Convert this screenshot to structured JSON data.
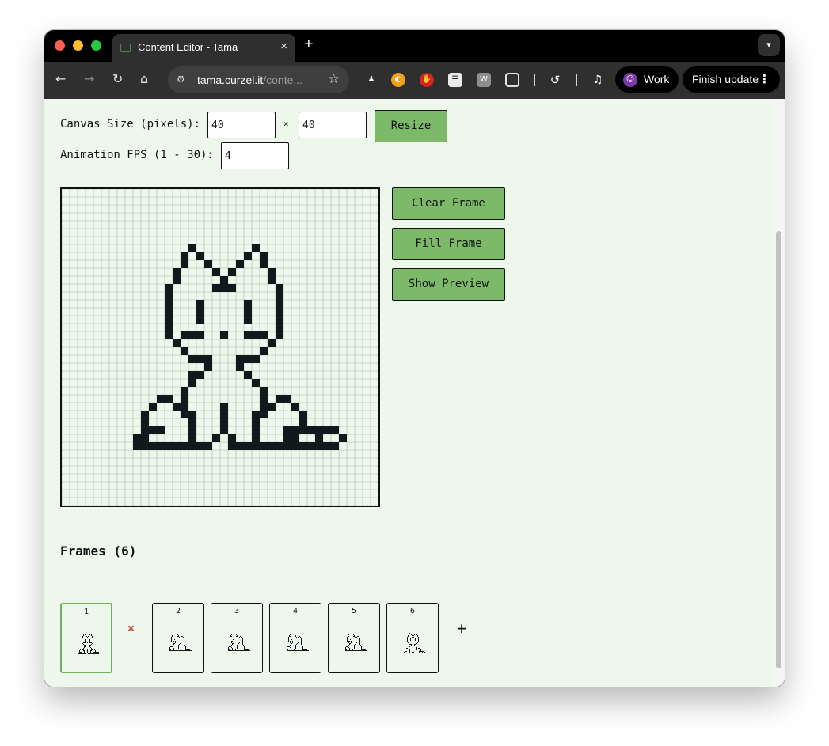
{
  "browser": {
    "tab_title": "Content Editor - Tama",
    "tab_close": "×",
    "new_tab": "+",
    "url_host": "tama.curzel.it",
    "url_path": "/conte...",
    "profile_name": "Work",
    "update_label": "Finish update"
  },
  "editor": {
    "canvas_size_label": "Canvas Size (pixels):",
    "width_value": "40",
    "times": "×",
    "height_value": "40",
    "resize_label": "Resize",
    "fps_label": "Animation FPS (1 - 30):",
    "fps_value": "4",
    "clear_label": "Clear Frame",
    "fill_label": "Fill Frame",
    "preview_label": "Show Preview"
  },
  "frames": {
    "title": "Frames (6)",
    "items": [
      {
        "label": "1",
        "selected": true
      },
      {
        "label": "2",
        "selected": false
      },
      {
        "label": "3",
        "selected": false
      },
      {
        "label": "4",
        "selected": false
      },
      {
        "label": "5",
        "selected": false
      },
      {
        "label": "6",
        "selected": false
      }
    ],
    "delete_symbol": "×",
    "add_symbol": "+"
  },
  "colors": {
    "accent": "#7cba69",
    "selected_border": "#6fb05c",
    "background": "#edf7ec",
    "grid": "#9fb8a8",
    "pixel": "#0f1a1c",
    "delete": "#d0463c"
  }
}
